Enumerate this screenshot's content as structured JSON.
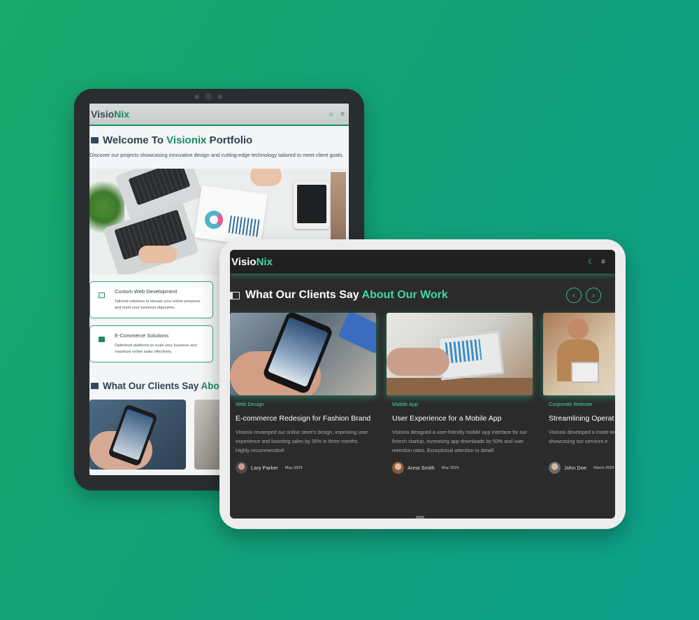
{
  "left_tablet": {
    "brand": {
      "part1": "Visio",
      "part2": "Nix"
    },
    "nav_icons": [
      "sun-icon",
      "menu-icon"
    ],
    "welcome": {
      "prefix": "Welcome To ",
      "accent": "Visionix",
      "suffix": " Portfolio"
    },
    "subtitle": "Discover our projects showcasing innovative design and cutting-edge technology tailored to meet client goals.",
    "services": [
      {
        "icon": "browser-icon",
        "title": "Custom Web Development",
        "desc1": "Tailored solutions to elevate your online presence",
        "desc2": "and meet your business objectives."
      },
      {
        "icon": "image-icon",
        "title": "E-Commerce Solutions",
        "desc1": "Optimized platforms to scale your business and",
        "desc2": "maximize online sales effectively."
      }
    ],
    "clients_heading": {
      "prefix": "What Our Clients Say ",
      "accent": "About Our Work"
    }
  },
  "right_tablet": {
    "brand": {
      "part1": "Visio",
      "part2": "Nix"
    },
    "nav_icons": [
      "moon-icon",
      "menu-icon"
    ],
    "heading": {
      "prefix": "What Our Clients Say ",
      "accent": "About Our Work"
    },
    "carousel": {
      "prev": "‹",
      "next": "›"
    },
    "cards": [
      {
        "category": "Web Design",
        "title": "E-commerce Redesign for Fashion Brand",
        "desc": "Visionix revamped our online store's design, improving user experience and boosting sales by 35% in three months. Highly recommended!",
        "author": "Lary Parker",
        "date": "May 2024"
      },
      {
        "category": "Mobile App",
        "title": "User Experience for a Mobile App",
        "desc": "Visionix designed a user-friendly mobile app interface for our fintech startup, increasing app downloads by 50% and user retention rates. Exceptional attention to detail!",
        "author": "Anna Smith",
        "date": "May 2024"
      },
      {
        "category": "Corporate Website",
        "title": "Streamlining Operat",
        "desc": "Visionix developed a mode tech company, simplifying showcasing our services e",
        "author": "John Doe",
        "date": "March 2024"
      }
    ]
  }
}
